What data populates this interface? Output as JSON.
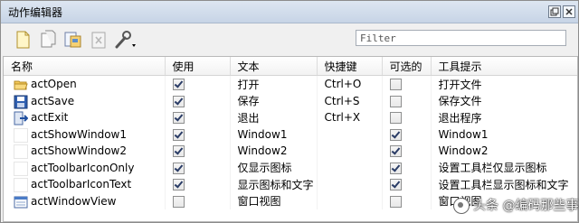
{
  "window": {
    "title": "动作编辑器",
    "float_icon": "float-icon",
    "close_icon": "close-icon"
  },
  "toolbar": {
    "icons": [
      "new-action-icon",
      "copy-icon",
      "edit-icon",
      "delete-icon",
      "wrench-dropdown-icon"
    ],
    "filter_placeholder": "Filter"
  },
  "table": {
    "columns": [
      "名称",
      "使用",
      "文本",
      "快捷键",
      "可选的",
      "工具提示"
    ],
    "rows": [
      {
        "icon": "folder-icon",
        "name": "actOpen",
        "used": true,
        "text": "打开",
        "shortcut": "Ctrl+O",
        "checkable": false,
        "tooltip": "打开文件"
      },
      {
        "icon": "save-icon",
        "name": "actSave",
        "used": true,
        "text": "保存",
        "shortcut": "Ctrl+S",
        "checkable": false,
        "tooltip": "保存文件"
      },
      {
        "icon": "exit-icon",
        "name": "actExit",
        "used": true,
        "text": "退出",
        "shortcut": "Ctrl+X",
        "checkable": false,
        "tooltip": "退出程序"
      },
      {
        "icon": "blank-icon",
        "name": "actShowWindow1",
        "used": true,
        "text": "Window1",
        "shortcut": "",
        "checkable": true,
        "tooltip": "Window1"
      },
      {
        "icon": "blank-icon",
        "name": "actShowWindow2",
        "used": true,
        "text": "Window2",
        "shortcut": "",
        "checkable": true,
        "tooltip": "Window2"
      },
      {
        "icon": "blank-icon",
        "name": "actToolbarIconOnly",
        "used": true,
        "text": "仅显示图标",
        "shortcut": "",
        "checkable": true,
        "tooltip": "设置工具栏仅显示图标"
      },
      {
        "icon": "blank-icon",
        "name": "actToolbarIconText",
        "used": true,
        "text": "显示图标和文字",
        "shortcut": "",
        "checkable": true,
        "tooltip": "设置工具栏显示图标和文字"
      },
      {
        "icon": "window-view-icon",
        "name": "actWindowView",
        "used": false,
        "text": "窗口视图",
        "shortcut": "",
        "checkable": false,
        "tooltip": "窗口视图"
      }
    ]
  },
  "watermark": {
    "text": "头条 @编码那些事"
  }
}
